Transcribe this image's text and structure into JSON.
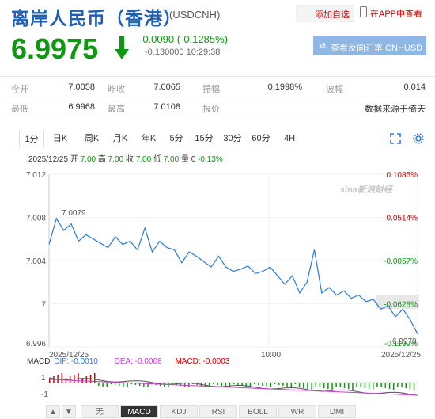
{
  "header": {
    "title": "离岸人民币（香港）",
    "code": "(USDCNH)",
    "add_watchlist": "添加自选",
    "app_label": "在APP中查看",
    "price": "6.9975",
    "change": "-0.0090 (-0.1285%)",
    "sub_info": "-0.130000 10:29:38",
    "reverse_button": "查看反向汇率 CNHUSD"
  },
  "stats": [
    {
      "label": "今开",
      "value": "7.0058"
    },
    {
      "label": "昨收",
      "value": "7.0065"
    },
    {
      "label": "振幅",
      "value": "0.1998%"
    },
    {
      "label": "波幅",
      "value": "0.014"
    },
    {
      "label": "最低",
      "value": "6.9968"
    },
    {
      "label": "最高",
      "value": "7.0108"
    },
    {
      "label": "报价",
      "value": "数据来源于倚天"
    }
  ],
  "tabs": [
    "1分",
    "日K",
    "周K",
    "月K",
    "年K",
    "5分",
    "15分",
    "30分",
    "60分",
    "4H"
  ],
  "active_tab": "1分",
  "ohlc_line": {
    "date": "2025/12/25",
    "open_label": "开",
    "open": "7.00",
    "high_label": "高",
    "high": "7.00",
    "close_label": "收",
    "close": "7.00",
    "low_label": "低",
    "low": "7.00",
    "vol_label": "量",
    "vol": "0",
    "pct": "-0.13%"
  },
  "chart_data": {
    "type": "line",
    "y_ticks": [
      "7.012",
      "7.008",
      "7.004",
      "7",
      "6.996"
    ],
    "pct_ticks": [
      "0.1085%",
      "0.0514%",
      "-0.0057%",
      "-0.0628%",
      "-0.1199%"
    ],
    "x_ticks": [
      "2025/12/25",
      "10:00",
      "2025/12/25"
    ],
    "max_label": "7.0079",
    "min_label": "6.9970",
    "watermark": "sina新浪财经",
    "ylim": [
      6.996,
      7.012
    ],
    "x": [
      0,
      2,
      4,
      6,
      8,
      10,
      12,
      14,
      16,
      18,
      20,
      22,
      24,
      26,
      28,
      30,
      32,
      34,
      36,
      38,
      40,
      42,
      44,
      46,
      48,
      50,
      52,
      54,
      56,
      58,
      60,
      62,
      64,
      66,
      68,
      70,
      72,
      74,
      76,
      78,
      80,
      82,
      84,
      86,
      88,
      90,
      92,
      94,
      96,
      98,
      100
    ],
    "values": [
      7.0055,
      7.0079,
      7.0068,
      7.0074,
      7.0058,
      7.0064,
      7.006,
      7.0056,
      7.0052,
      7.0062,
      7.0055,
      7.0058,
      7.005,
      7.007,
      7.0048,
      7.0058,
      7.0052,
      7.005,
      7.0038,
      7.0048,
      7.0044,
      7.0039,
      7.0034,
      7.0044,
      7.0034,
      7.003,
      7.0032,
      7.0035,
      7.0028,
      7.003,
      7.0034,
      7.0026,
      7.0018,
      7.0026,
      7.001,
      7.002,
      7.005,
      7.001,
      7.0015,
      7.0008,
      7.0012,
      7.0005,
      7.0008,
      7.0002,
      7.0004,
      6.9995,
      6.9998,
      6.9988,
      6.9995,
      6.9985,
      6.9972
    ],
    "macd": {
      "dif_label": "DIF: -0.0010",
      "dea_label": "DEA: -0.0008",
      "macd_label": "MACD: -0.0003",
      "y_ticks": [
        "1",
        "-1"
      ]
    }
  },
  "bottom_tabs": [
    "无",
    "MACD",
    "KDJ",
    "RSI",
    "BOLL",
    "WR",
    "DMI"
  ],
  "active_bottom_tab": "MACD",
  "colors": {
    "blue": "#1f5fb4",
    "green": "#119611",
    "red": "#cc0000",
    "line": "#2b7bd0"
  }
}
